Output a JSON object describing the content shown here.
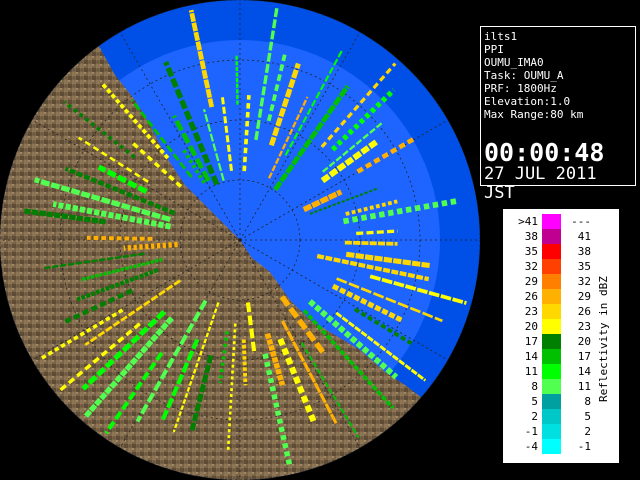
{
  "info": {
    "lines": [
      "ilts1",
      "PPI",
      "OUMU_IMA0",
      "Task: OUMU_A",
      "PRF: 1800Hz",
      "Elevation:1.0",
      "Max Range:80 km"
    ],
    "clock": "00:00:48",
    "date": "27 JUL 2011 JST"
  },
  "legend": {
    "title": "Reflectivity in dBZ",
    "rows": [
      {
        "low": ">41",
        "high": "---",
        "color": "#ff00ff"
      },
      {
        "low": "38",
        "high": "41",
        "color": "#c00090"
      },
      {
        "low": "35",
        "high": "38",
        "color": "#ff0000"
      },
      {
        "low": "32",
        "high": "35",
        "color": "#ff4000"
      },
      {
        "low": "29",
        "high": "32",
        "color": "#ff8000"
      },
      {
        "low": "26",
        "high": "29",
        "color": "#ffb000"
      },
      {
        "low": "23",
        "high": "26",
        "color": "#ffd800"
      },
      {
        "low": "20",
        "high": "23",
        "color": "#ffff00"
      },
      {
        "low": "17",
        "high": "20",
        "color": "#008000"
      },
      {
        "low": "14",
        "high": "17",
        "color": "#00c000"
      },
      {
        "low": "11",
        "high": "14",
        "color": "#00ff00"
      },
      {
        "low": "8",
        "high": "11",
        "color": "#50ff50"
      },
      {
        "low": "5",
        "high": "8",
        "color": "#00a0a0"
      },
      {
        "low": "2",
        "high": "5",
        "color": "#00c8c8"
      },
      {
        "low": "-1",
        "high": "2",
        "color": "#00e0e0"
      },
      {
        "low": "-4",
        "high": "-1",
        "color": "#00ffff"
      }
    ]
  },
  "map": {
    "sea_color": "#1e64ff",
    "outer_sea_color": "#0050e8",
    "land_color": "#7a6448",
    "out_of_range_color": "#000000"
  }
}
